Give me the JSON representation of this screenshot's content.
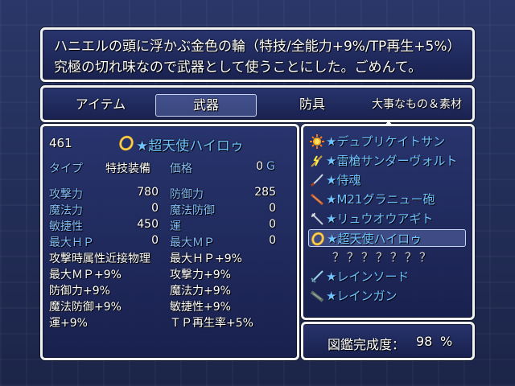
{
  "help": {
    "line1": "ハニエルの頭に浮かぶ金色の輪（特技/全能力+9%/TP再生+5%）",
    "line2": "究極の切れ味なので武器として使うことにした。ごめんて。"
  },
  "tabs": [
    {
      "label": "アイテム",
      "selected": false
    },
    {
      "label": "武器",
      "selected": true
    },
    {
      "label": "防具",
      "selected": false
    },
    {
      "label": "大事なもの＆素材",
      "selected": false
    }
  ],
  "status": {
    "id": "461",
    "item_name": "★超天使ハイロゥ",
    "type_label": "タイプ",
    "type_value": "特技装備",
    "price_label": "価格",
    "price_value": "0",
    "currency": "G",
    "params": [
      {
        "label": "攻撃力",
        "value": "780"
      },
      {
        "label": "防御力",
        "value": "285"
      },
      {
        "label": "魔法力",
        "value": "0"
      },
      {
        "label": "魔法防御",
        "value": "0"
      },
      {
        "label": "敏捷性",
        "value": "450"
      },
      {
        "label": "運",
        "value": "0"
      },
      {
        "label": "最大ＨＰ",
        "value": "0"
      },
      {
        "label": "最大ＭＰ",
        "value": "0"
      }
    ],
    "traits": [
      "攻撃時属性近接物理",
      "最大ＨＰ+9%",
      "最大ＭＰ+9%",
      "攻撃力+9%",
      "防御力+9%",
      "魔法力+9%",
      "魔法防御+9%",
      "敏捷性+9%",
      "運+9%",
      "ＴＰ再生率+5%"
    ]
  },
  "items": [
    {
      "name": "★デュプリケイトサン",
      "icon": "sun-icon",
      "known": true
    },
    {
      "name": "★雷槍サンダーヴォルト",
      "icon": "lightning-spear-icon",
      "known": true
    },
    {
      "name": "★侍魂",
      "icon": "katana-icon",
      "known": true
    },
    {
      "name": "★M21グラニュー砲",
      "icon": "cannon-icon",
      "known": true
    },
    {
      "name": "★リュウオウアギト",
      "icon": "claw-spear-icon",
      "known": true
    },
    {
      "name": "★超天使ハイロゥ",
      "icon": "halo-ring-icon",
      "known": true,
      "selected": true
    },
    {
      "name": "？？？？？？？",
      "icon": "",
      "known": false
    },
    {
      "name": "★レインソード",
      "icon": "sword-icon",
      "known": true
    },
    {
      "name": "★レインガン",
      "icon": "gun-icon",
      "known": true
    }
  ],
  "completion": {
    "label": "図鑑完成度：",
    "value": "98",
    "unit": "%"
  },
  "colors": {
    "system_text": "#84bfff",
    "item_name": "#6fc3ff",
    "window_border": "#f2f2f2"
  }
}
